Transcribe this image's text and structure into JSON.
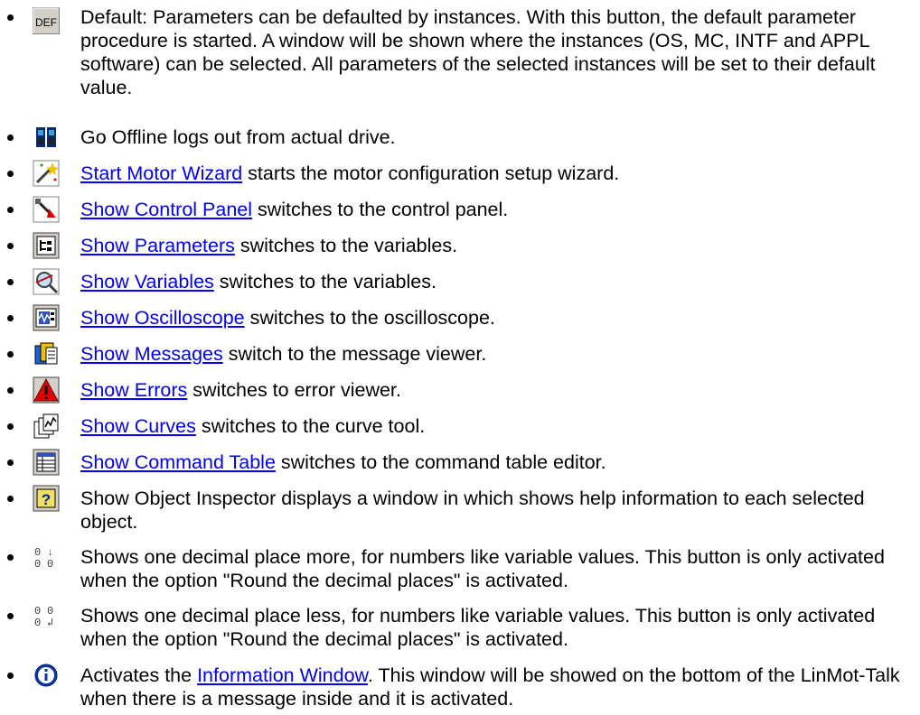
{
  "colors": {
    "link": "#0000ee",
    "text": "#000000",
    "background": "#ffffff"
  },
  "items": [
    {
      "icon": "def-icon",
      "icon_label": "DEF",
      "link": "",
      "text": "Default: Parameters can be defaulted by instances. With this button, the default parameter procedure is started. A window will be shown where the instances (OS, MC, INTF and APPL software) can be selected. All parameters of the selected instances will be set to their default value."
    },
    {
      "icon": "go-offline-icon",
      "link": "",
      "text": "Go Offline logs out from actual drive."
    },
    {
      "icon": "motor-wizard-icon",
      "link": "Start Motor Wizard",
      "text": " starts the motor configuration setup wizard."
    },
    {
      "icon": "control-panel-icon",
      "link": "Show Control Panel",
      "text": " switches to the control panel."
    },
    {
      "icon": "parameters-icon",
      "link": "Show Parameters",
      "text": " switches to the variables."
    },
    {
      "icon": "variables-icon",
      "link": "Show Variables",
      "text": " switches to the variables."
    },
    {
      "icon": "oscilloscope-icon",
      "link": "Show Oscilloscope",
      "text": " switches to the oscilloscope."
    },
    {
      "icon": "messages-icon",
      "link": "Show Messages",
      "text": " switch to the message viewer."
    },
    {
      "icon": "errors-icon",
      "link": "Show Errors",
      "text": " switches to error viewer."
    },
    {
      "icon": "curves-icon",
      "link": "Show Curves",
      "text": " switches to the curve tool."
    },
    {
      "icon": "command-table-icon",
      "link": "Show Command Table",
      "text": " switches to the command table editor."
    },
    {
      "icon": "object-inspector-icon",
      "link": "",
      "text": "Show Object Inspector displays a window in which shows help information to each selected object."
    },
    {
      "icon": "decimal-more-icon",
      "link": "",
      "text": "Shows one decimal place more, for numbers like variable values. This button is only activated when the option \"Round the decimal places\" is activated."
    },
    {
      "icon": "decimal-less-icon",
      "link": "",
      "text": "Shows one decimal place less, for numbers like variable values. This button is only activated when the option \"Round the decimal places\" is activated."
    },
    {
      "icon": "information-icon",
      "link": "",
      "pre": "Activates the ",
      "link2": "Information Window",
      "text": ". This window will be showed on the bottom of the LinMot-Talk when there is a message inside and it is activated."
    }
  ]
}
